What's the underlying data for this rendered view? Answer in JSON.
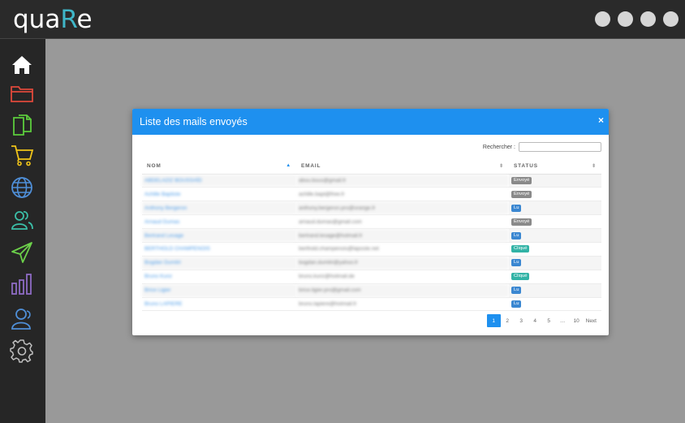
{
  "app": {
    "logo_prefix": "qua",
    "logo_accent": "R",
    "logo_suffix": "e"
  },
  "window_controls": [
    "circle-1",
    "circle-2",
    "circle-3",
    "circle-4"
  ],
  "sidebar": {
    "items": [
      {
        "name": "home",
        "icon": "home-icon",
        "color": "#ffffff"
      },
      {
        "name": "folder",
        "icon": "folder-icon",
        "color": "#e0493b"
      },
      {
        "name": "documents",
        "icon": "documents-icon",
        "color": "#5ccc3c"
      },
      {
        "name": "cart",
        "icon": "cart-icon",
        "color": "#f0c419"
      },
      {
        "name": "web",
        "icon": "globe-icon",
        "color": "#4f8fd8"
      },
      {
        "name": "contacts",
        "icon": "users-icon",
        "color": "#3bbfa8"
      },
      {
        "name": "send",
        "icon": "send-icon",
        "color": "#6cd04a"
      },
      {
        "name": "stats",
        "icon": "bar-chart-icon",
        "color": "#8e6bc4"
      },
      {
        "name": "users",
        "icon": "user-group-icon",
        "color": "#4f8fd8"
      },
      {
        "name": "settings",
        "icon": "gear-icon",
        "color": "#bfbfbf"
      }
    ]
  },
  "modal": {
    "title": "Liste des mails envoyés",
    "close_icon": "×",
    "search_label": "Rechercher :",
    "search_value": "",
    "columns": [
      "NOM",
      "EMAIL",
      "STATUS"
    ],
    "rows": [
      {
        "name": "ABDELAZIZ BOUSSAÏD",
        "email": "abou.bous@gmail.fr",
        "status": "Envoyé",
        "status_color": "#8a8a8a"
      },
      {
        "name": "Achille Baptiste",
        "email": "achille.bapt@free.fr",
        "status": "Envoyé",
        "status_color": "#8a8a8a"
      },
      {
        "name": "Anthony Bergeron",
        "email": "anthony.bergeron.pro@orange.fr",
        "status": "Lu",
        "status_color": "#3a87d1"
      },
      {
        "name": "Arnaud Dumas",
        "email": "arnaud.dumas@gmail.com",
        "status": "Envoyé",
        "status_color": "#8a8a8a"
      },
      {
        "name": "Bertrand Lesage",
        "email": "bertrand.lesage@hotmail.fr",
        "status": "Lu",
        "status_color": "#3a87d1"
      },
      {
        "name": "BERTHOLD CHAMPENOIS",
        "email": "berthold.champenois@laposte.net",
        "status": "Cliqué",
        "status_color": "#32b3a6"
      },
      {
        "name": "Bogdan Dumitri",
        "email": "bogdan.dumitri@yahoo.fr",
        "status": "Lu",
        "status_color": "#3a87d1"
      },
      {
        "name": "Bruno Kunz",
        "email": "bruno.kunz@hotmail.de",
        "status": "Cliqué",
        "status_color": "#32b3a6"
      },
      {
        "name": "Brice Ligier",
        "email": "brice.ligier.pro@gmail.com",
        "status": "Lu",
        "status_color": "#3a87d1"
      },
      {
        "name": "Bruno LAPIERE",
        "email": "bruno.lapiere@hotmail.fr",
        "status": "Lu",
        "status_color": "#3a87d1"
      }
    ],
    "pagination": [
      "1",
      "2",
      "3",
      "4",
      "5",
      "…",
      "10",
      "Next"
    ],
    "current_page": "1"
  }
}
